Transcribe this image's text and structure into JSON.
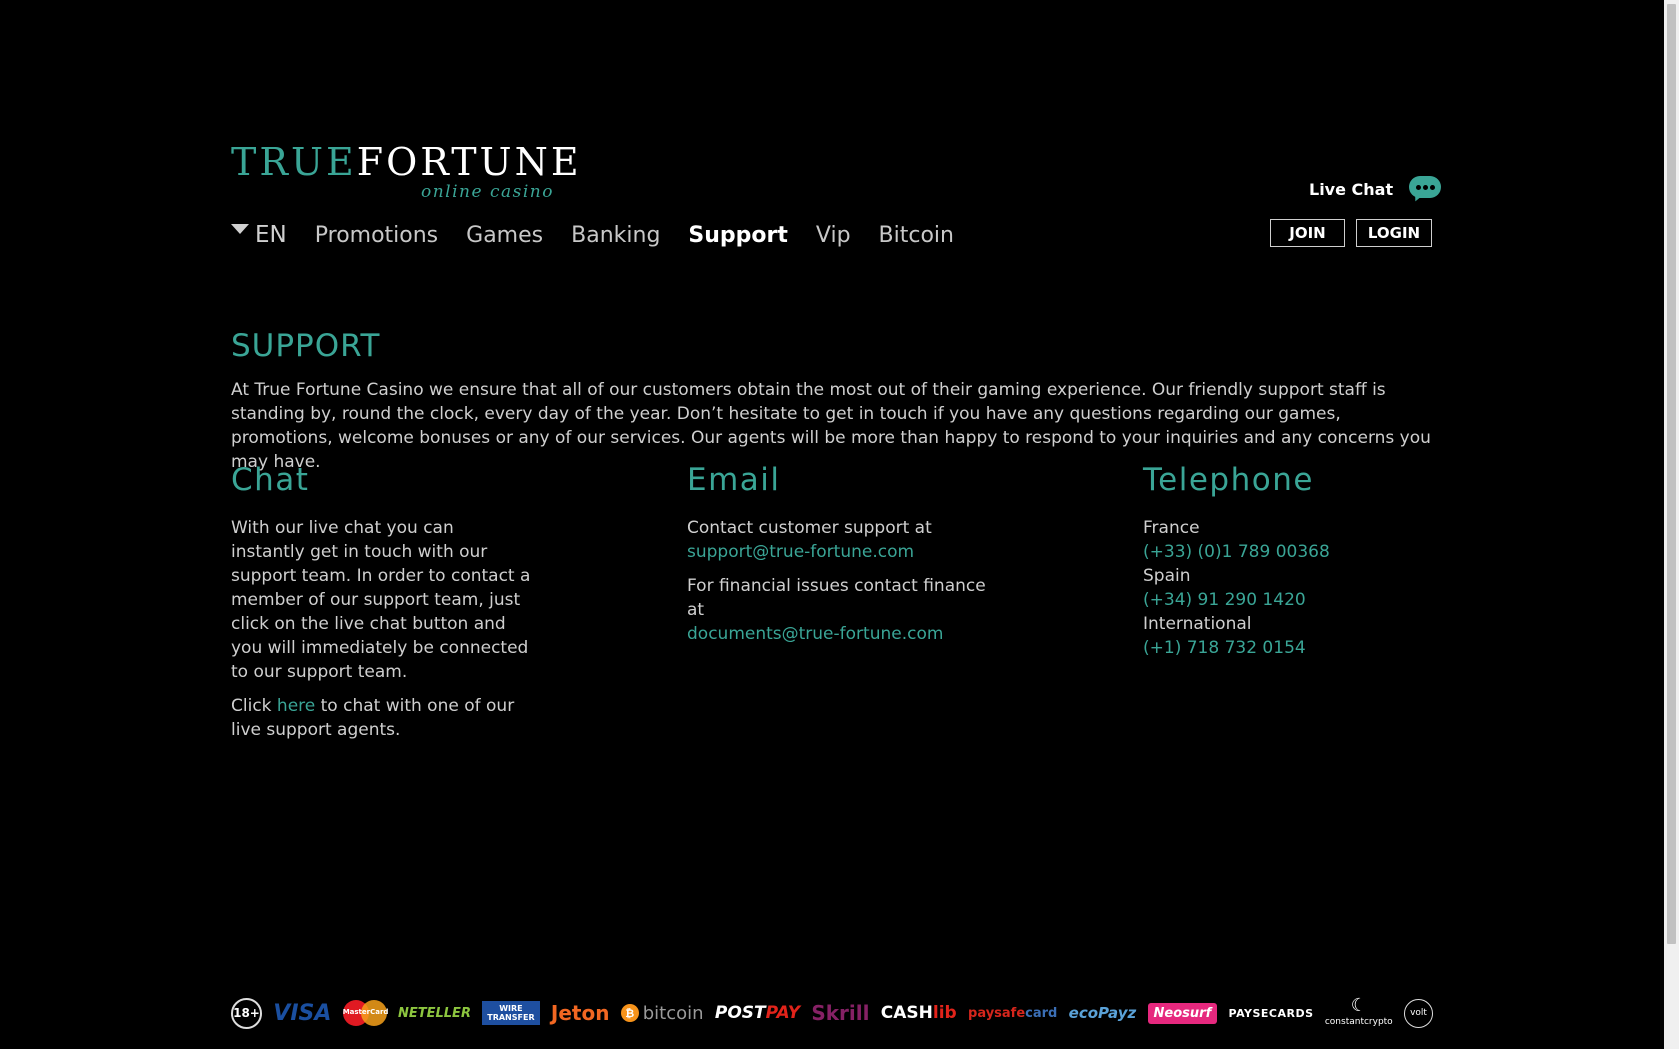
{
  "logo": {
    "part1": "TRUE",
    "part2": "FORTUNE",
    "tagline": "online casino"
  },
  "nav": {
    "language": "EN",
    "items": [
      "Promotions",
      "Games",
      "Banking",
      "Support",
      "Vip",
      "Bitcoin"
    ],
    "active": "Support"
  },
  "header": {
    "live_chat": "Live Chat",
    "join": "JOIN",
    "login": "LOGIN"
  },
  "page": {
    "title": "SUPPORT",
    "intro": "At True Fortune Casino we ensure that all of our customers obtain the most out of their gaming experience. Our friendly support staff is standing by, round the clock, every day of the year. Don’t hesitate to get in touch if you have any questions regarding our games, promotions, welcome bonuses or any of our services. Our agents will be more than happy to respond to your inquiries and any concerns you may have."
  },
  "chat": {
    "heading": "Chat",
    "text": "With our live chat you can instantly get in touch with our support team. In order to contact a member of our support team, just click on the live chat button and you will immediately be connected to our support team.",
    "click_prefix": "Click ",
    "click_link": "here",
    "click_suffix": " to chat with one of our live support agents."
  },
  "email": {
    "heading": "Email",
    "text1": "Contact customer support at",
    "address1": "support@true-fortune.com",
    "text2": "For financial issues contact finance at",
    "address2": "documents@true-fortune.com"
  },
  "telephone": {
    "heading": "Telephone",
    "entries": [
      {
        "country": "France",
        "number": "(+33) (0)1 789 00368"
      },
      {
        "country": "Spain",
        "number": "(+34) 91 290 1420"
      },
      {
        "country": "International",
        "number": "(+1) 718 732 0154"
      }
    ]
  },
  "payments": {
    "age": "18+",
    "visa": "VISA",
    "mastercard": "MasterCard",
    "neteller": "NETELLER",
    "wire_line1": "WIRE",
    "wire_line2": "TRANSFER",
    "jeton": "Jeton",
    "bitcoin": "bitcoin",
    "postpay_a": "POST",
    "postpay_b": "PAY",
    "skrill": "Skrill",
    "cashlib_a": "CASH",
    "cashlib_b": "lib",
    "paysafe_a": "paysafe",
    "paysafe_b": "card",
    "ecopayz": "ecoPayz",
    "neosurf": "Neosurf",
    "paysecards": "PAYSECARDS",
    "constantcrypto": "constantcrypto",
    "volt": "volt"
  },
  "colors": {
    "accent": "#3aa596",
    "background": "#000000"
  }
}
